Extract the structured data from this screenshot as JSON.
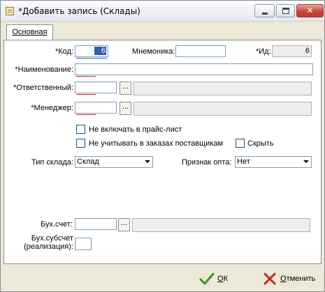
{
  "window": {
    "title": "*Добавить запись (Склады)",
    "close_glyph": "✕"
  },
  "tabs": [
    {
      "label": "Основная"
    }
  ],
  "form": {
    "code_label": "*Код:",
    "code_value": "6",
    "mnemonic_label": "Мнемоника:",
    "mnemonic_value": "",
    "id_label": "*Ид:",
    "id_value": "6",
    "name_label": "*Наименование:",
    "name_value": "",
    "responsible_label": "*Ответственный:",
    "responsible_value": "",
    "responsible_display": "",
    "manager_label": "*Менеджер:",
    "manager_value": "",
    "manager_display": "",
    "dots_label": "...",
    "check_exclude_price": "Не включать в прайс-лист",
    "check_exclude_orders": "Не учитывать в заказах поставщикам",
    "check_hide": "Скрыть",
    "warehouse_type_label": "Тип склада:",
    "warehouse_type_value": "Склад",
    "wholesale_label": "Признак опта:",
    "wholesale_value": "Нет",
    "account_label": "Бух.счет:",
    "account_value": "",
    "account_display": "",
    "subaccount_label_line1": "Бух.субсчет",
    "subaccount_label_line2": "(реализация):",
    "subaccount_value": ""
  },
  "buttons": {
    "ok_label": "ОК",
    "ok_accel": "О",
    "ok_rest": "К",
    "cancel_accel": "О",
    "cancel_rest": "тменить"
  },
  "icons": {
    "ok": "checkmark-icon",
    "cancel": "cross-icon",
    "app": "form-icon"
  },
  "colors": {
    "ok_icon": "#2e9a1f",
    "cancel_icon": "#c0281e",
    "required_underline": "#e02020",
    "selection": "#2f5fa8"
  }
}
